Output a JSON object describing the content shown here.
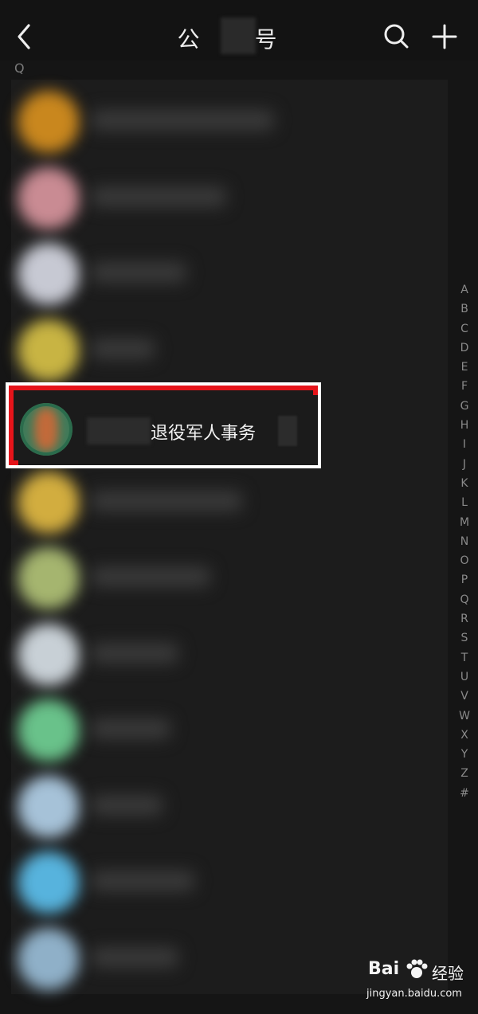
{
  "header": {
    "title": "公 号",
    "back_icon": "back-arrow-icon",
    "search_icon": "search-icon",
    "add_icon": "plus-icon"
  },
  "section_letter": "Q",
  "list": {
    "rows": [
      {
        "avatar_color": "#c9871e"
      },
      {
        "avatar_color": "#c98b93"
      },
      {
        "avatar_color": "#c7c9d3"
      },
      {
        "avatar_color": "#c8b443"
      },
      {
        "highlighted": true
      },
      {
        "avatar_color": "#d2ad3f"
      },
      {
        "avatar_color": "#a5b56f"
      },
      {
        "avatar_color": "#c8d0d6"
      },
      {
        "avatar_color": "#69c28a"
      },
      {
        "avatar_color": "#a6c2d8"
      },
      {
        "avatar_color": "#57b3dd"
      },
      {
        "avatar_color": "#8fb0c8"
      }
    ],
    "highlighted_item": {
      "name": "退役军人事务"
    }
  },
  "index_letters": [
    "A",
    "B",
    "C",
    "D",
    "E",
    "F",
    "G",
    "H",
    "I",
    "J",
    "K",
    "L",
    "M",
    "N",
    "O",
    "P",
    "Q",
    "R",
    "S",
    "T",
    "U",
    "V",
    "W",
    "X",
    "Y",
    "Z",
    "#"
  ],
  "watermark": {
    "logo": "Bai",
    "brand": "经验",
    "url": "jingyan.baidu.com"
  },
  "colors": {
    "background": "#151515",
    "list_bg": "#1c1c1c",
    "highlight_border": "#e5141a"
  }
}
